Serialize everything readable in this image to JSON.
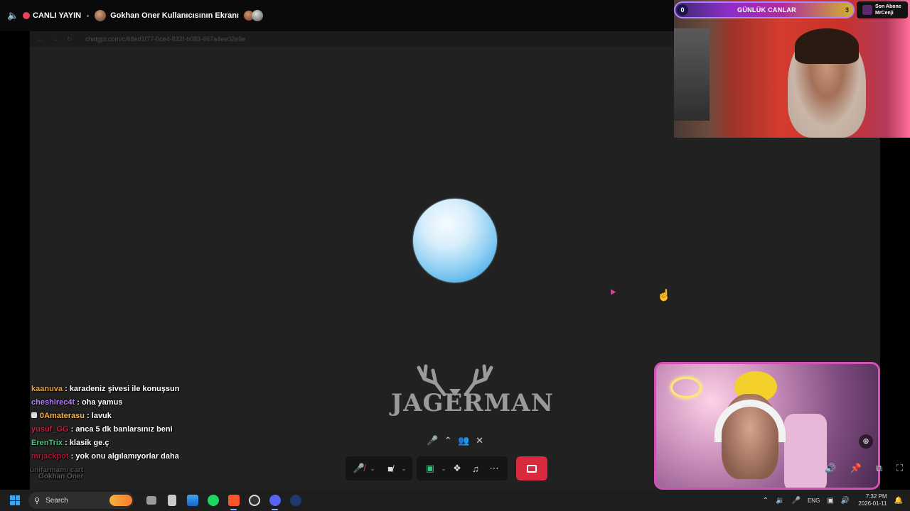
{
  "topbar": {
    "live_label": "CANLI YAYIN",
    "screen_title": "Gokhan Oner Kullanıcısının Ekranı"
  },
  "browser": {
    "url": "chatgpt.com/c/68ed1f77-0ce4-832f-b083-667a4ee02e9e"
  },
  "overlay": {
    "goal_count": "0",
    "goal_label": "GÜNLÜK CANLAR",
    "goal_target": "3",
    "sub_title": "Son Abone",
    "sub_name": "MrCenji"
  },
  "watermark": {
    "text": "JAGERMAN"
  },
  "chat": {
    "messages": [
      {
        "user": "kaanuva",
        "text": "karadeniz şivesi ile konuşsun",
        "color": "#e0a23c"
      },
      {
        "user": "cheshirec4t",
        "text": "oha yamus",
        "color": "#b57cff"
      },
      {
        "user": "0Amaterasu",
        "text": "lavuk",
        "color": "#ffb347"
      },
      {
        "user": "yusuf_GG",
        "text": "anca 5 dk banlarsınız beni",
        "color": "#c81e46"
      },
      {
        "user": "ErenTrix",
        "text": "klasik ge.ç",
        "color": "#49c27d"
      },
      {
        "user": "mrjackpot",
        "text": "yok onu algılamıyorlar daha",
        "color": "#b5152f"
      }
    ],
    "faded_text": "ünifarmamı cart",
    "name_tag": "Gokhan Oner"
  },
  "taskbar": {
    "search_placeholder": "Search",
    "lang": "ENG",
    "time": "7:32 PM",
    "date": "2026-01-11"
  },
  "icons": {
    "speaker": "speaker-icon",
    "mic_muted": "mic-muted-icon",
    "camera_off": "camera-off-icon",
    "screen_share": "screen-share-icon",
    "activities": "activities-icon",
    "soundboard": "soundboard-icon",
    "more": "more-icon",
    "end_call": "end-call-icon"
  }
}
